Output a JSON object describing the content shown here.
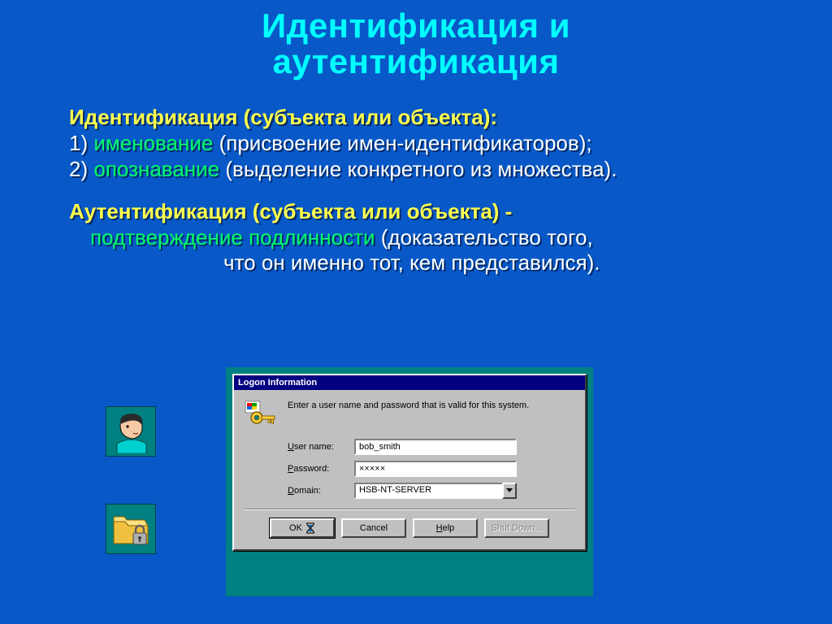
{
  "title_line1": "Идентификация и",
  "title_line2": "аутентификация",
  "section1": {
    "heading": "Идентификация (субъекта или объекта):",
    "item1": {
      "num": "1)",
      "kw": "именование",
      "rest": " (присвоение имен-идентификаторов);"
    },
    "item2": {
      "num": "2)",
      "kw": "опознавание",
      "rest": " (выделение конкретного из множества)."
    }
  },
  "section2": {
    "heading": "Аутентификация (субъекта или объекта) -",
    "line1_kw": "подтверждение подлинности",
    "line1_rest": " (доказательство того,",
    "line2": "что он именно тот, кем представился)."
  },
  "dialog": {
    "title": "Logon Information",
    "message": "Enter a user name and password that is valid for this system.",
    "labels": {
      "username_u": "U",
      "username_rest": "ser name:",
      "password_u": "P",
      "password_rest": "assword:",
      "domain_u": "D",
      "domain_rest": "omain:"
    },
    "values": {
      "username": "bob_smith",
      "password": "×××××",
      "domain": "HSB-NT-SERVER"
    },
    "buttons": {
      "ok": "OK",
      "cancel": "Cancel",
      "help_u": "H",
      "help_rest": "elp",
      "shutdown": "Shut Down..."
    }
  }
}
